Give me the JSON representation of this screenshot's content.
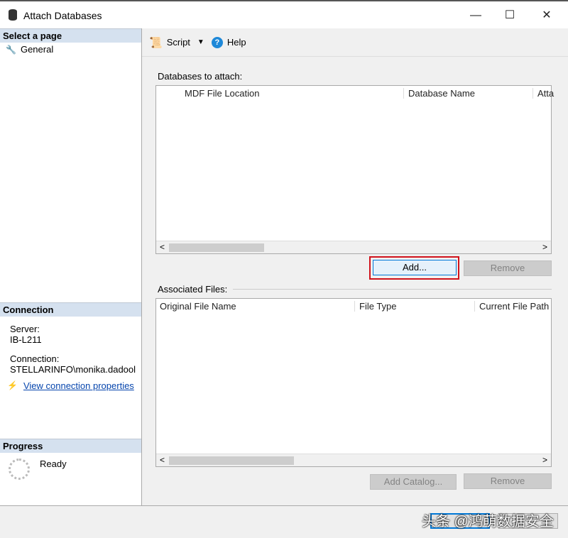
{
  "window": {
    "title": "Attach Databases",
    "icon": "database-icon"
  },
  "sidebar": {
    "select_page_header": "Select a page",
    "pages": [
      {
        "label": "General",
        "icon": "wrench-icon"
      }
    ],
    "connection_header": "Connection",
    "server_label": "Server:",
    "server_value": "IB-L211",
    "connection_label": "Connection:",
    "connection_value": "STELLARINFO\\monika.dadool",
    "view_connection_link": "View connection properties",
    "progress_header": "Progress",
    "progress_status": "Ready"
  },
  "toolbar": {
    "script_label": "Script",
    "help_label": "Help"
  },
  "main": {
    "databases_label": "Databases to attach:",
    "databases_columns": [
      "MDF File Location",
      "Database Name",
      "Atta"
    ],
    "add_button": "Add...",
    "remove_button": "Remove",
    "associated_label": "Associated Files:",
    "associated_columns": [
      "Original File Name",
      "File Type",
      "Current File Path"
    ],
    "add_catalog_button": "Add Catalog...",
    "remove_button2": "Remove"
  },
  "watermark": "头条 @鸿萌数据安全",
  "colors": {
    "highlight": "#d0121b",
    "section": "#d5e1ef"
  }
}
